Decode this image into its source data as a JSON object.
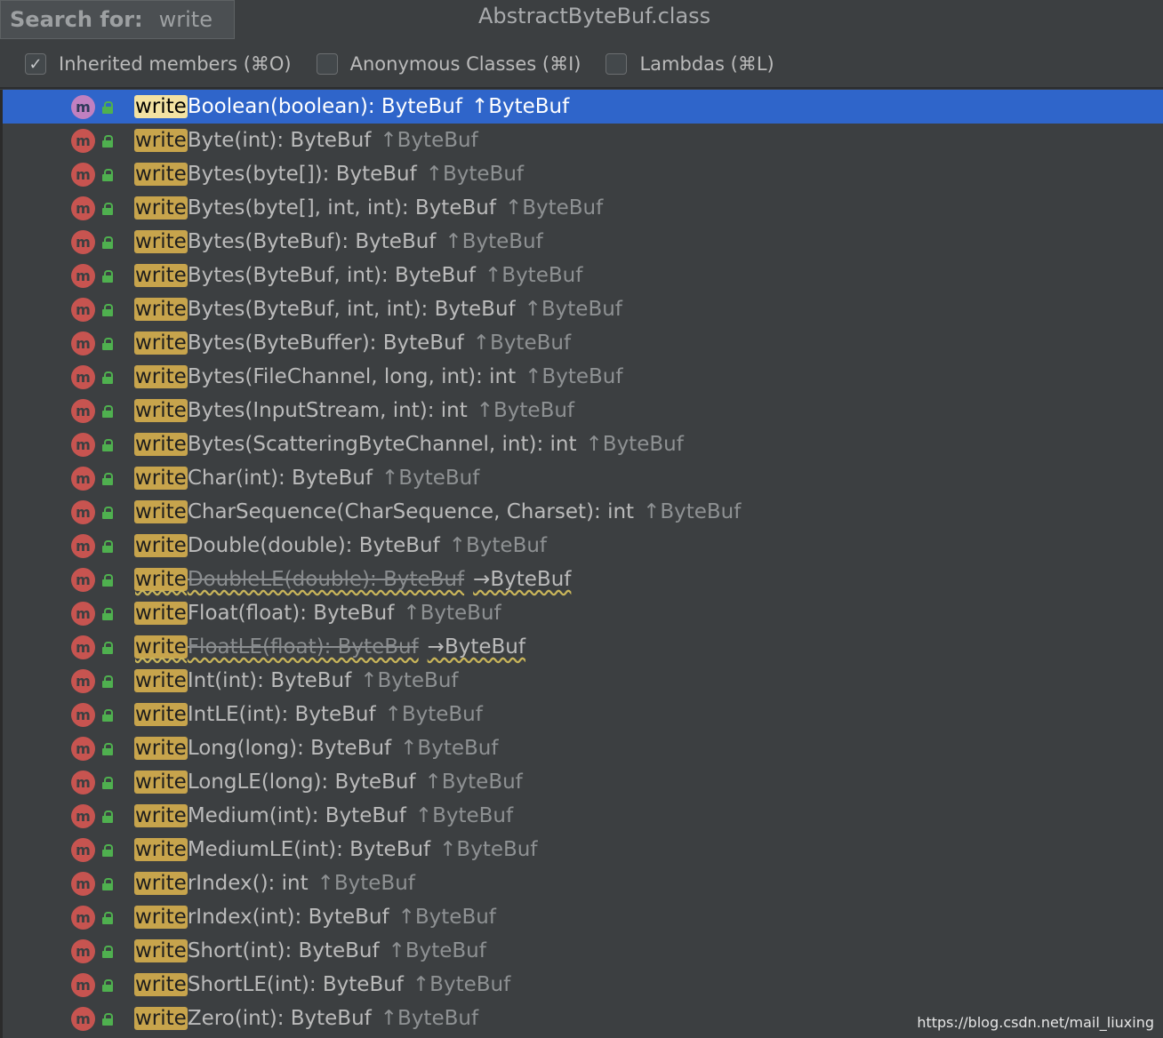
{
  "search": {
    "label": "Search for:",
    "value": "write"
  },
  "window": {
    "title": "AbstractByteBuf.class"
  },
  "options": [
    {
      "label": "Inherited members (⌘O)",
      "checked": true
    },
    {
      "label": "Anonymous Classes (⌘I)",
      "checked": false
    },
    {
      "label": "Lambdas (⌘L)",
      "checked": false
    }
  ],
  "members": [
    {
      "prefix": "write",
      "rest": "Boolean(boolean): ByteBuf",
      "origin": "↑ByteBuf",
      "selected": true
    },
    {
      "prefix": "write",
      "rest": "Byte(int): ByteBuf",
      "origin": "↑ByteBuf"
    },
    {
      "prefix": "write",
      "rest": "Bytes(byte[]): ByteBuf",
      "origin": "↑ByteBuf"
    },
    {
      "prefix": "write",
      "rest": "Bytes(byte[], int, int): ByteBuf",
      "origin": "↑ByteBuf"
    },
    {
      "prefix": "write",
      "rest": "Bytes(ByteBuf): ByteBuf",
      "origin": "↑ByteBuf"
    },
    {
      "prefix": "write",
      "rest": "Bytes(ByteBuf, int): ByteBuf",
      "origin": "↑ByteBuf"
    },
    {
      "prefix": "write",
      "rest": "Bytes(ByteBuf, int, int): ByteBuf",
      "origin": "↑ByteBuf"
    },
    {
      "prefix": "write",
      "rest": "Bytes(ByteBuffer): ByteBuf",
      "origin": "↑ByteBuf"
    },
    {
      "prefix": "write",
      "rest": "Bytes(FileChannel, long, int): int",
      "origin": "↑ByteBuf"
    },
    {
      "prefix": "write",
      "rest": "Bytes(InputStream, int): int",
      "origin": "↑ByteBuf"
    },
    {
      "prefix": "write",
      "rest": "Bytes(ScatteringByteChannel, int): int",
      "origin": "↑ByteBuf"
    },
    {
      "prefix": "write",
      "rest": "Char(int): ByteBuf",
      "origin": "↑ByteBuf"
    },
    {
      "prefix": "write",
      "rest": "CharSequence(CharSequence, Charset): int",
      "origin": "↑ByteBuf"
    },
    {
      "prefix": "write",
      "rest": "Double(double): ByteBuf",
      "origin": "↑ByteBuf"
    },
    {
      "prefix": "write",
      "rest": "DoubleLE(double): ByteBuf",
      "origin": "→ByteBuf",
      "deprecated": true
    },
    {
      "prefix": "write",
      "rest": "Float(float): ByteBuf",
      "origin": "↑ByteBuf"
    },
    {
      "prefix": "write",
      "rest": "FloatLE(float): ByteBuf",
      "origin": "→ByteBuf",
      "deprecated": true
    },
    {
      "prefix": "write",
      "rest": "Int(int): ByteBuf",
      "origin": "↑ByteBuf"
    },
    {
      "prefix": "write",
      "rest": "IntLE(int): ByteBuf",
      "origin": "↑ByteBuf"
    },
    {
      "prefix": "write",
      "rest": "Long(long): ByteBuf",
      "origin": "↑ByteBuf"
    },
    {
      "prefix": "write",
      "rest": "LongLE(long): ByteBuf",
      "origin": "↑ByteBuf"
    },
    {
      "prefix": "write",
      "rest": "Medium(int): ByteBuf",
      "origin": "↑ByteBuf"
    },
    {
      "prefix": "write",
      "rest": "MediumLE(int): ByteBuf",
      "origin": "↑ByteBuf"
    },
    {
      "prefix": "write",
      "rest": "rIndex(): int",
      "origin": "↑ByteBuf"
    },
    {
      "prefix": "write",
      "rest": "rIndex(int): ByteBuf",
      "origin": "↑ByteBuf"
    },
    {
      "prefix": "write",
      "rest": "Short(int): ByteBuf",
      "origin": "↑ByteBuf"
    },
    {
      "prefix": "write",
      "rest": "ShortLE(int): ByteBuf",
      "origin": "↑ByteBuf"
    },
    {
      "prefix": "write",
      "rest": "Zero(int): ByteBuf",
      "origin": "↑ByteBuf"
    }
  ],
  "icons": {
    "member_kind": "method-icon",
    "member_kind_letter": "m",
    "visibility": "public-lock-icon"
  },
  "colors": {
    "selection": "#2f65ca",
    "match_highlight": "#c7a44c",
    "method_icon": "#c75450",
    "lock": "#4fb04f"
  },
  "watermark": "https://blog.csdn.net/mail_liuxing"
}
